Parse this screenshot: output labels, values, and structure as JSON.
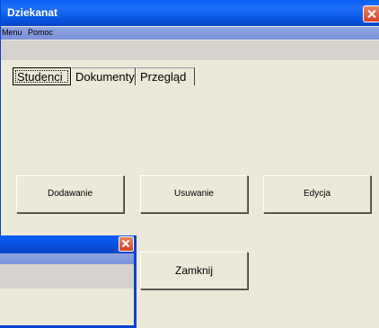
{
  "window": {
    "title": "Dziekanat"
  },
  "menu": {
    "items": [
      "Menu",
      "Pomoc"
    ]
  },
  "tabs": [
    "Studenci",
    "Dokumenty",
    "Przegląd"
  ],
  "buttons": {
    "add": "Dodawanie",
    "remove": "Usuwanie",
    "edit": "Edycja",
    "close": "Zamknij"
  }
}
